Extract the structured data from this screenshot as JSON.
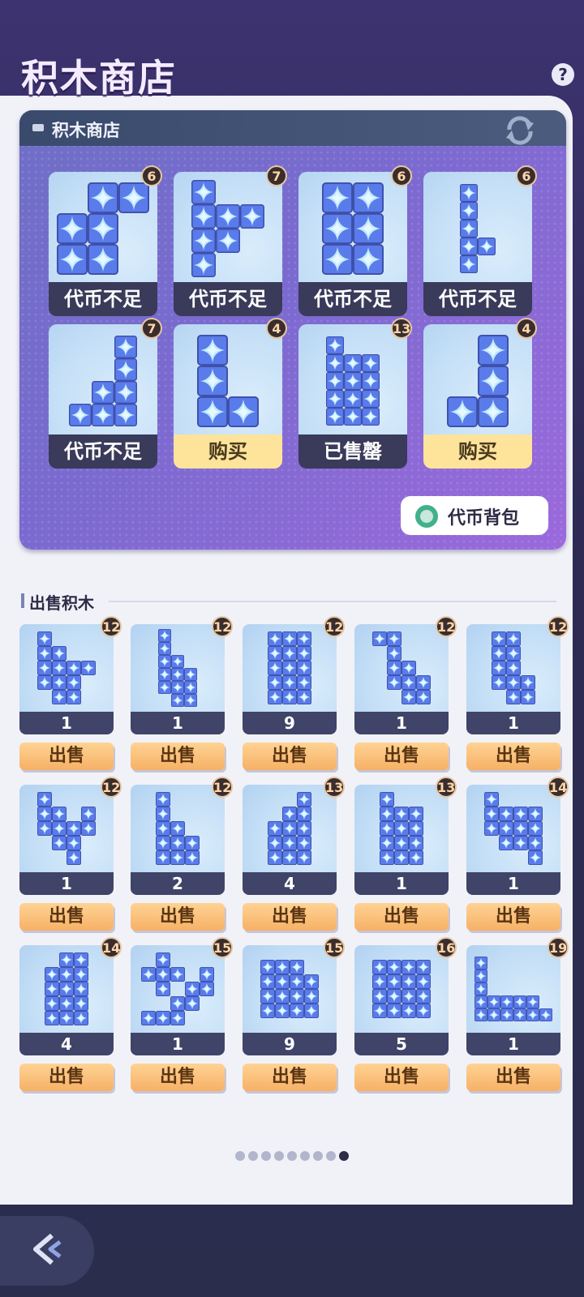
{
  "page": {
    "title": "积木商店",
    "help_label": "?"
  },
  "shop": {
    "title": "积木商店",
    "items": [
      {
        "price": "6",
        "status": "代币不足",
        "buyable": false
      },
      {
        "price": "7",
        "status": "代币不足",
        "buyable": false
      },
      {
        "price": "6",
        "status": "代币不足",
        "buyable": false
      },
      {
        "price": "6",
        "status": "代币不足",
        "buyable": false
      },
      {
        "price": "7",
        "status": "代币不足",
        "buyable": false
      },
      {
        "price": "4",
        "status": "购买",
        "buyable": true
      },
      {
        "price": "13",
        "status": "已售罄",
        "buyable": false
      },
      {
        "price": "4",
        "status": "购买",
        "buyable": true
      }
    ],
    "token_bag_label": "代币背包"
  },
  "sell": {
    "title": "出售积木",
    "button_label": "出售",
    "items": [
      {
        "level": "12",
        "count": "1"
      },
      {
        "level": "12",
        "count": "1"
      },
      {
        "level": "12",
        "count": "9"
      },
      {
        "level": "12",
        "count": "1"
      },
      {
        "level": "12",
        "count": "1"
      },
      {
        "level": "12",
        "count": "1"
      },
      {
        "level": "12",
        "count": "2"
      },
      {
        "level": "13",
        "count": "4"
      },
      {
        "level": "13",
        "count": "1"
      },
      {
        "level": "14",
        "count": "1"
      },
      {
        "level": "14",
        "count": "4"
      },
      {
        "level": "15",
        "count": "1"
      },
      {
        "level": "15",
        "count": "9"
      },
      {
        "level": "16",
        "count": "5"
      },
      {
        "level": "19",
        "count": "1"
      }
    ]
  },
  "pager": {
    "total": 9,
    "active": 9
  },
  "colors": {
    "accent": "#7b6ad0",
    "buy": "#fde49a",
    "sell": "#f6b166",
    "dark": "#3a3a5a"
  },
  "icons": {
    "refresh": "refresh-icon",
    "token": "token-ring-icon",
    "back": "back-arrow-icon",
    "help": "help-icon"
  }
}
